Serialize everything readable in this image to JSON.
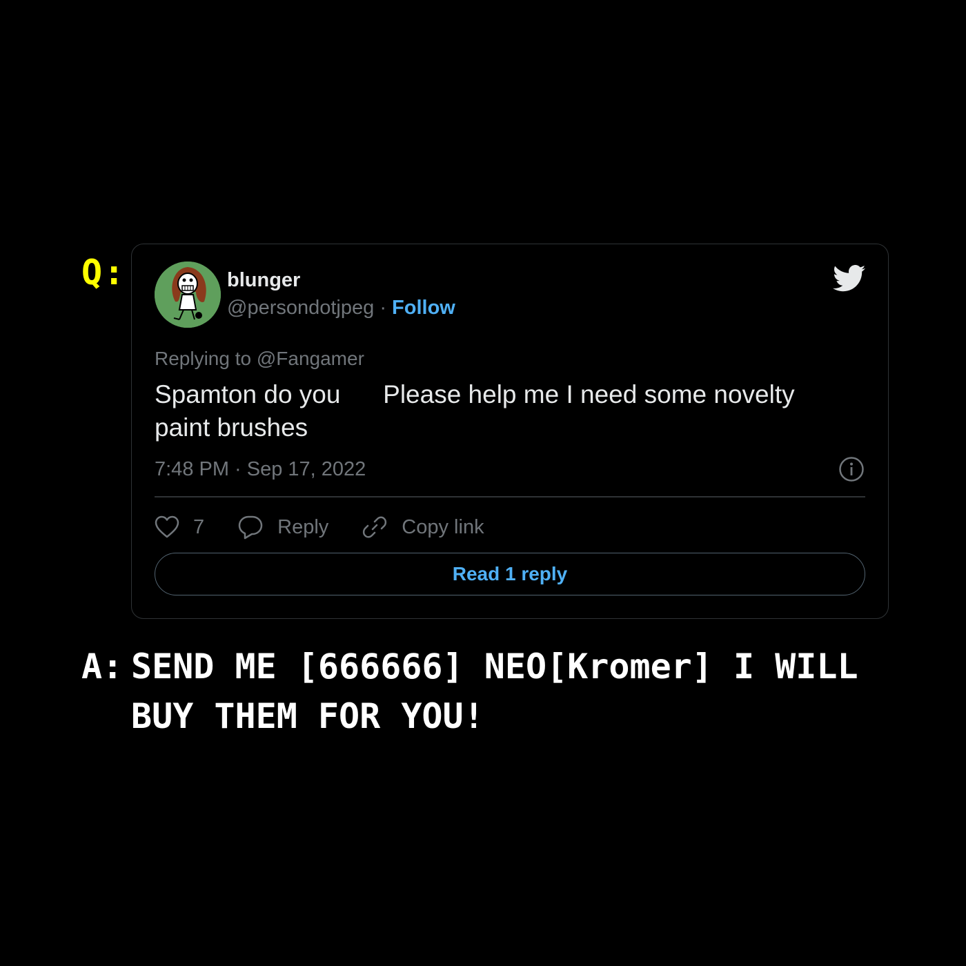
{
  "question_label": "Q:",
  "answer_label": "A:",
  "answer_text": "SEND ME [666666] NEO[Kromer] I WILL BUY THEM FOR YOU!",
  "tweet": {
    "display_name": "blunger",
    "handle": "@persondotjpeg",
    "separator": " · ",
    "follow_label": "Follow",
    "replying_to": "Replying to @Fangamer",
    "body_lines": [
      "Spamton do you      Please help me I need some novelty",
      "paint brushes"
    ],
    "timestamp": "7:48 PM · Sep 17, 2022",
    "like_count": "7",
    "reply_label": "Reply",
    "copy_link_label": "Copy link",
    "read_replies_label": "Read 1 reply"
  },
  "icons": {
    "brand": "twitter-bird-icon",
    "info": "info-icon",
    "like": "heart-icon",
    "reply": "speech-bubble-icon",
    "link": "link-icon"
  },
  "colors": {
    "background": "#000000",
    "question_label": "#ffff00",
    "answer_text": "#ffffff",
    "accent": "#4fb0f5",
    "secondary_text": "#71767b",
    "primary_text": "#e7e9ea",
    "avatar_bg": "#5f9f5c"
  }
}
